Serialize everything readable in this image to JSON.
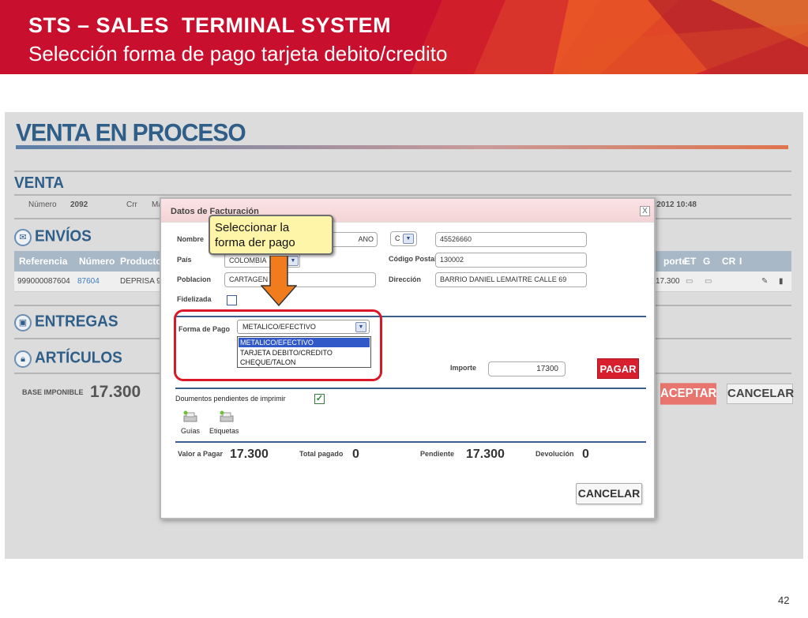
{
  "slide": {
    "title": "STS – SALES  TERMINAL SYSTEM",
    "subtitle": "Selección forma de pago tarjeta debito/credito",
    "page_number": "42",
    "colors": {
      "header_red": "#c8102e",
      "highlight_red": "#d9182a",
      "callout_yellow": "#fff5a8",
      "arrow_orange": "#f07c1e"
    }
  },
  "app": {
    "title": "VENTA EN PROCESO",
    "venta": {
      "title": "VENTA",
      "numero_label": "Número",
      "numero_value": "2092",
      "crr_label": "Crr",
      "ma_label": "Ma",
      "date_fragment": ":2012 10:48"
    },
    "envios": {
      "title": "ENVÍOS",
      "icon": "envelope-icon",
      "columns": [
        "Referencia",
        "Número",
        "Producto",
        "porte",
        "ET",
        "G",
        "CR",
        "I"
      ],
      "row": {
        "referencia": "999000087604",
        "numero": "87604",
        "producto": "DEPRISA 9",
        "importe": "17.300"
      }
    },
    "entregas": {
      "title": "ENTREGAS",
      "icon": "truck-icon"
    },
    "articulos": {
      "title": "ARTÍCULOS",
      "icon": "lock-icon"
    },
    "base_imponible_label": "BASE IMPONIBLE",
    "base_imponible_value": "17.300",
    "aceptar_label": "ACEPTAR",
    "cancelar_label": "CANCELAR"
  },
  "dialog": {
    "title": "Datos de Facturación",
    "close": "X",
    "nombre_label": "Nombre",
    "nombre_value": "ANO",
    "doc_type_value": "C",
    "doc_number_value": "45526660",
    "pais_label": "País",
    "pais_value": "COLOMBIA",
    "codigo_postal_label": "Código Postal",
    "codigo_postal_value": "130002",
    "poblacion_label": "Poblacion",
    "poblacion_value": "CARTAGEN",
    "direccion_label": "Dirección",
    "direccion_value": "BARRIO DANIEL LEMAITRE CALLE 69",
    "fidelizada_label": "Fidelizada",
    "forma_pago_label": "Forma de Pago",
    "forma_pago_selected": "METALICO/EFECTIVO",
    "forma_pago_options": [
      "METALICO/EFECTIVO",
      "TARJETA DEBITO/CREDITO",
      "CHEQUE/TALON"
    ],
    "importe_label": "Importe",
    "importe_value": "17300",
    "pagar_label": "PAGAR",
    "documentos_label": "Doumentos pendientes de imprimir",
    "documentos_checked": true,
    "guias_label": "Guías",
    "etiquetas_label": "Etiquetas",
    "valor_pagar_label": "Valor a Pagar",
    "valor_pagar_value": "17.300",
    "total_pagado_label": "Total pagado",
    "total_pagado_value": "0",
    "pendiente_label": "Pendiente",
    "pendiente_value": "17.300",
    "devolucion_label": "Devolución",
    "devolucion_value": "0",
    "cancelar_label": "CANCELAR"
  },
  "callout": {
    "line1": "Seleccionar la",
    "line2": "forma der pago"
  }
}
